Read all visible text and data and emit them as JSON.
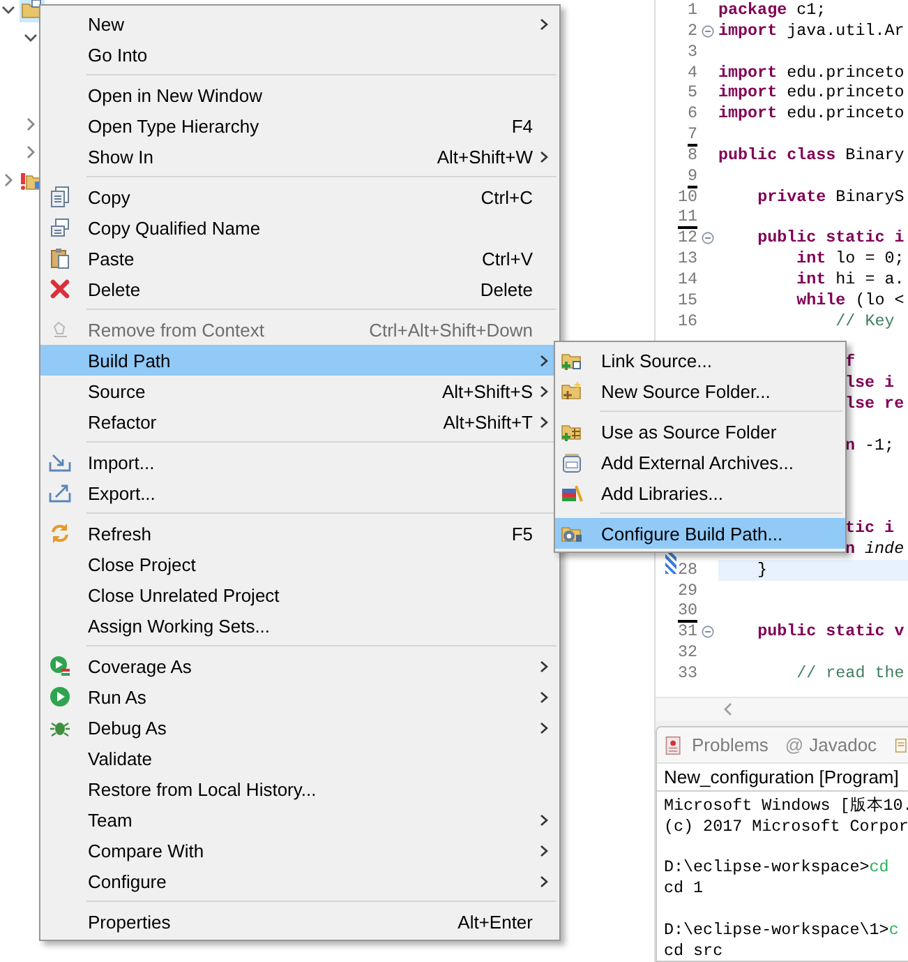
{
  "explorer": {
    "tree": [
      {
        "kind": "project",
        "expanded": true,
        "selected": true,
        "children": [
          {
            "expanded": true
          },
          {
            "expanded": false
          },
          {
            "expanded": false
          }
        ]
      },
      {
        "kind": "project-error",
        "expanded": false,
        "selected": false
      }
    ]
  },
  "editor": {
    "lines": [
      {
        "kind": "code",
        "number": "1",
        "code": "**package** c1;",
        "fold": false,
        "marked": false,
        "current": false
      },
      {
        "kind": "code",
        "number": "2",
        "code": "**import** java.util.Ar",
        "fold": true,
        "marked": false,
        "current": false
      },
      {
        "kind": "code",
        "number": "3",
        "fold": false,
        "marked": false,
        "current": false
      },
      {
        "kind": "code",
        "number": "4",
        "code": "**import** edu.princeto",
        "fold": false,
        "marked": false,
        "current": false
      },
      {
        "kind": "code",
        "number": "5",
        "code": "**import** edu.princeto",
        "fold": false,
        "marked": false,
        "current": false
      },
      {
        "kind": "code",
        "number": "6",
        "code": "**import** edu.princeto",
        "fold": false,
        "marked": false,
        "current": false
      },
      {
        "kind": "code",
        "number": "7",
        "fold": false,
        "marked": true,
        "current": false
      },
      {
        "kind": "code",
        "number": "8",
        "code": "**public class** Binary",
        "fold": false,
        "marked": false,
        "current": false
      },
      {
        "kind": "code",
        "number": "9",
        "fold": false,
        "marked": true,
        "current": false
      },
      {
        "kind": "code",
        "number": "10",
        "code": "    **private** BinaryS",
        "fold": false,
        "marked": false,
        "current": false
      },
      {
        "kind": "code",
        "number": "11",
        "fold": false,
        "marked": true,
        "current": false
      },
      {
        "kind": "code",
        "number": "12",
        "code": "    **public static i**",
        "fold": true,
        "marked": false,
        "current": false
      },
      {
        "kind": "code",
        "number": "13",
        "code": "        **int** lo = 0;",
        "fold": false,
        "marked": false,
        "current": false
      },
      {
        "kind": "code",
        "number": "14",
        "code": "        **int** hi = a.",
        "fold": false,
        "marked": false,
        "current": false
      },
      {
        "kind": "code",
        "number": "15",
        "code": "        **while** (lo <",
        "fold": false,
        "marked": false,
        "current": false
      },
      {
        "kind": "comment",
        "number": "16",
        "code": "            // Key",
        "fold": false,
        "marked": false,
        "current": false
      },
      {
        "kind": "hidden",
        "fold": false,
        "current": false
      },
      {
        "kind": "partial",
        "code": "**f**",
        "fold": false,
        "current": false
      },
      {
        "kind": "partial",
        "code": "**lse i**",
        "fold": false,
        "current": false
      },
      {
        "kind": "partial",
        "code": "**lse re**",
        "fold": false,
        "current": false
      },
      {
        "kind": "hidden",
        "fold": false,
        "current": false
      },
      {
        "kind": "partial",
        "code": "**n** -1;",
        "fold": false,
        "current": false
      },
      {
        "kind": "hidden",
        "fold": false,
        "current": false
      },
      {
        "kind": "hidden",
        "fold": false,
        "current": false
      },
      {
        "kind": "hidden",
        "fold": false,
        "current": false
      },
      {
        "kind": "partial",
        "code": "**tic i**",
        "fold": false,
        "current": false
      },
      {
        "kind": "partial",
        "code": "**n** *inde*",
        "fold": false,
        "current": false
      },
      {
        "kind": "code",
        "number": "28",
        "code": "    }",
        "fold": false,
        "marked": false,
        "current": true
      },
      {
        "kind": "code",
        "number": "29",
        "fold": false,
        "marked": false,
        "current": false
      },
      {
        "kind": "code",
        "number": "30",
        "fold": false,
        "marked": true,
        "current": false
      },
      {
        "kind": "code",
        "number": "31",
        "code": "    **public static v**",
        "fold": true,
        "marked": false,
        "current": false
      },
      {
        "kind": "code",
        "number": "32",
        "fold": false,
        "marked": false,
        "current": false
      },
      {
        "kind": "comment",
        "number": "33",
        "code": "        // read the",
        "fold": false,
        "marked": false,
        "current": false
      }
    ]
  },
  "console": {
    "tabs": [
      {
        "label": "Problems",
        "selected": false
      },
      {
        "icon_text": "@",
        "label": "Javadoc",
        "selected": false
      }
    ],
    "title": "New_configuration [Program]",
    "lines": [
      {
        "kind": "output",
        "text": "Microsoft Windows [版本10."
      },
      {
        "kind": "output",
        "text": "(c) 2017 Microsoft Corpor"
      },
      {
        "kind": "blank"
      },
      {
        "kind": "command",
        "prompt": "D:\\eclipse-workspace>",
        "input": "cd"
      },
      {
        "kind": "output",
        "text": "cd 1"
      },
      {
        "kind": "blank"
      },
      {
        "kind": "command",
        "prompt": "D:\\eclipse-workspace\\1>",
        "input": "c"
      },
      {
        "kind": "output",
        "text": "cd src"
      }
    ]
  },
  "context_menu": {
    "items": [
      {
        "kind": "item",
        "label": "New",
        "submenu": true,
        "selected": false,
        "disabled": false
      },
      {
        "kind": "item",
        "label": "Go Into",
        "submenu": false,
        "selected": false,
        "disabled": false
      },
      {
        "kind": "separator"
      },
      {
        "kind": "item",
        "label": "Open in New Window",
        "submenu": false,
        "selected": false,
        "disabled": false
      },
      {
        "kind": "item",
        "label": "Open Type Hierarchy",
        "shortcut": "F4",
        "submenu": false,
        "selected": false,
        "disabled": false
      },
      {
        "kind": "item",
        "label": "Show In",
        "shortcut": "Alt+Shift+W",
        "submenu": true,
        "selected": false,
        "disabled": false
      },
      {
        "kind": "separator"
      },
      {
        "kind": "item",
        "label": "Copy",
        "shortcut": "Ctrl+C",
        "submenu": false,
        "selected": false,
        "disabled": false
      },
      {
        "kind": "item",
        "label": "Copy Qualified Name",
        "submenu": false,
        "selected": false,
        "disabled": false
      },
      {
        "kind": "item",
        "label": "Paste",
        "shortcut": "Ctrl+V",
        "submenu": false,
        "selected": false,
        "disabled": false
      },
      {
        "kind": "item",
        "label": "Delete",
        "shortcut": "Delete",
        "submenu": false,
        "selected": false,
        "disabled": false
      },
      {
        "kind": "separator"
      },
      {
        "kind": "item",
        "label": "Remove from Context",
        "shortcut": "Ctrl+Alt+Shift+Down",
        "submenu": false,
        "selected": false,
        "disabled": true
      },
      {
        "kind": "item",
        "label": "Build Path",
        "submenu": true,
        "selected": true,
        "disabled": false
      },
      {
        "kind": "item",
        "label": "Source",
        "shortcut": "Alt+Shift+S",
        "submenu": true,
        "selected": false,
        "disabled": false
      },
      {
        "kind": "item",
        "label": "Refactor",
        "shortcut": "Alt+Shift+T",
        "submenu": true,
        "selected": false,
        "disabled": false
      },
      {
        "kind": "separator"
      },
      {
        "kind": "item",
        "label": "Import...",
        "submenu": false,
        "selected": false,
        "disabled": false
      },
      {
        "kind": "item",
        "label": "Export...",
        "submenu": false,
        "selected": false,
        "disabled": false
      },
      {
        "kind": "separator"
      },
      {
        "kind": "item",
        "label": "Refresh",
        "shortcut": "F5",
        "submenu": false,
        "selected": false,
        "disabled": false
      },
      {
        "kind": "item",
        "label": "Close Project",
        "submenu": false,
        "selected": false,
        "disabled": false
      },
      {
        "kind": "item",
        "label": "Close Unrelated Project",
        "submenu": false,
        "selected": false,
        "disabled": false
      },
      {
        "kind": "item",
        "label": "Assign Working Sets...",
        "submenu": false,
        "selected": false,
        "disabled": false
      },
      {
        "kind": "separator"
      },
      {
        "kind": "item",
        "label": "Coverage As",
        "submenu": true,
        "selected": false,
        "disabled": false
      },
      {
        "kind": "item",
        "label": "Run As",
        "submenu": true,
        "selected": false,
        "disabled": false
      },
      {
        "kind": "item",
        "label": "Debug As",
        "submenu": true,
        "selected": false,
        "disabled": false
      },
      {
        "kind": "item",
        "label": "Validate",
        "submenu": false,
        "selected": false,
        "disabled": false
      },
      {
        "kind": "item",
        "label": "Restore from Local History...",
        "submenu": false,
        "selected": false,
        "disabled": false
      },
      {
        "kind": "item",
        "label": "Team",
        "submenu": true,
        "selected": false,
        "disabled": false
      },
      {
        "kind": "item",
        "label": "Compare With",
        "submenu": true,
        "selected": false,
        "disabled": false
      },
      {
        "kind": "item",
        "label": "Configure",
        "submenu": true,
        "selected": false,
        "disabled": false
      },
      {
        "kind": "separator"
      },
      {
        "kind": "item",
        "label": "Properties",
        "shortcut": "Alt+Enter",
        "submenu": false,
        "selected": false,
        "disabled": false
      }
    ]
  },
  "build_path_submenu": {
    "items": [
      {
        "kind": "item",
        "label": "Link Source...",
        "submenu": false,
        "selected": false,
        "disabled": false
      },
      {
        "kind": "item",
        "label": "New Source Folder...",
        "submenu": false,
        "selected": false,
        "disabled": false
      },
      {
        "kind": "separator"
      },
      {
        "kind": "item",
        "label": "Use as Source Folder",
        "submenu": false,
        "selected": false,
        "disabled": false
      },
      {
        "kind": "item",
        "label": "Add External Archives...",
        "submenu": false,
        "selected": false,
        "disabled": false
      },
      {
        "kind": "item",
        "label": "Add Libraries...",
        "submenu": false,
        "selected": false,
        "disabled": false
      },
      {
        "kind": "separator"
      },
      {
        "kind": "item",
        "label": "Configure Build Path...",
        "submenu": false,
        "selected": true,
        "disabled": false
      }
    ]
  }
}
